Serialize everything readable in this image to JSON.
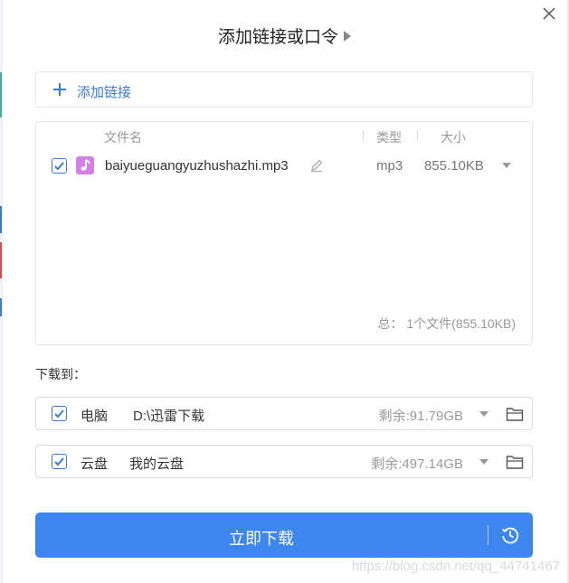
{
  "dialog": {
    "title": "添加链接或口令",
    "close_icon": "close-icon",
    "title_arrow_icon": "triangle-right-icon"
  },
  "add_link": {
    "label": "添加链接",
    "icon": "plus-icon"
  },
  "file_table": {
    "columns": [
      "文件名",
      "类型",
      "大小"
    ],
    "rows": [
      {
        "checked": true,
        "icon": "music-note-icon",
        "name": "baiyueguangyuzhushazhi.mp3",
        "type": "mp3",
        "size": "855.10KB"
      }
    ],
    "total": "总：  1个文件(855.10KB)"
  },
  "download_to": {
    "label": "下载到：",
    "destinations": [
      {
        "checked": true,
        "kind": "电脑",
        "path": "D:\\迅雷下载",
        "free": "剩余:91.79GB"
      },
      {
        "checked": true,
        "kind": "云盘",
        "path": "我的云盘",
        "free": "剩余:497.14GB"
      }
    ]
  },
  "download_button": {
    "label": "立即下载",
    "history_icon": "clock-icon"
  },
  "watermark": "https://blog.csdn.net/qq_44741467",
  "colors": {
    "accent": "#3a7bd5",
    "button": "#3d86ee",
    "music_icon": "#d57ee5",
    "border": "#e4e7ed",
    "muted_text": "#999999"
  }
}
